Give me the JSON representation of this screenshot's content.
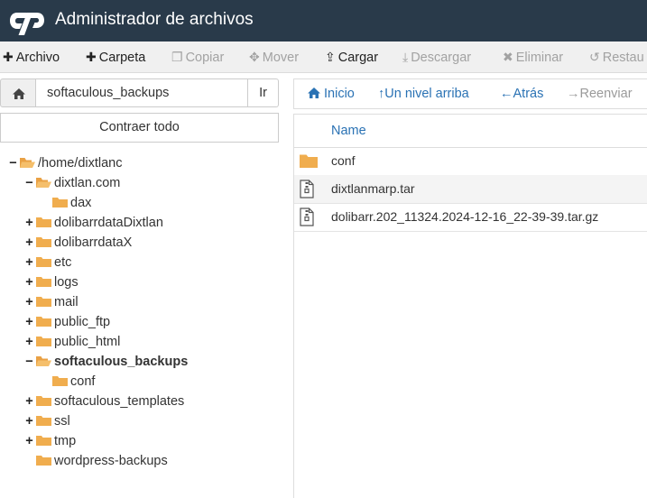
{
  "app": {
    "title": "Administrador de archivos"
  },
  "toolbar": {
    "items": [
      {
        "label": "Archivo",
        "icon": "plus-icon",
        "enabled": true
      },
      {
        "label": "Carpeta",
        "icon": "plus-icon",
        "enabled": true
      },
      {
        "label": "Copiar",
        "icon": "copy-icon",
        "enabled": false
      },
      {
        "label": "Mover",
        "icon": "move-icon",
        "enabled": false
      },
      {
        "label": "Cargar",
        "icon": "upload-icon",
        "enabled": true
      },
      {
        "label": "Descargar",
        "icon": "download-icon",
        "enabled": false
      },
      {
        "label": "Eliminar",
        "icon": "close-icon",
        "enabled": false
      },
      {
        "label": "Restau",
        "icon": "undo-icon",
        "enabled": false
      }
    ]
  },
  "path": {
    "value": "softaculous_backups",
    "go_label": "Ir"
  },
  "tree": {
    "collapse_label": "Contraer todo",
    "items": [
      {
        "label": "/home/dixtlanc",
        "toggle": "−",
        "open": true,
        "bold": false
      },
      {
        "label": "dixtlan.com",
        "toggle": "−",
        "open": true,
        "bold": false
      },
      {
        "label": "dax",
        "toggle": "",
        "open": false,
        "bold": false
      },
      {
        "label": "dolibarrdataDixtlan",
        "toggle": "+",
        "open": false,
        "bold": false
      },
      {
        "label": "dolibarrdataX",
        "toggle": "+",
        "open": false,
        "bold": false
      },
      {
        "label": "etc",
        "toggle": "+",
        "open": false,
        "bold": false
      },
      {
        "label": "logs",
        "toggle": "+",
        "open": false,
        "bold": false
      },
      {
        "label": "mail",
        "toggle": "+",
        "open": false,
        "bold": false
      },
      {
        "label": "public_ftp",
        "toggle": "+",
        "open": false,
        "bold": false
      },
      {
        "label": "public_html",
        "toggle": "+",
        "open": false,
        "bold": false
      },
      {
        "label": "softaculous_backups",
        "toggle": "−",
        "open": true,
        "bold": true
      },
      {
        "label": "conf",
        "toggle": "",
        "open": false,
        "bold": false
      },
      {
        "label": "softaculous_templates",
        "toggle": "+",
        "open": false,
        "bold": false
      },
      {
        "label": "ssl",
        "toggle": "+",
        "open": false,
        "bold": false
      },
      {
        "label": "tmp",
        "toggle": "+",
        "open": false,
        "bold": false
      },
      {
        "label": "wordpress-backups",
        "toggle": "",
        "open": false,
        "bold": false
      }
    ]
  },
  "nav": {
    "items": [
      {
        "label": "Inicio",
        "icon": "home-icon",
        "enabled": true
      },
      {
        "label": "Un nivel arriba",
        "icon": "level-up-icon",
        "enabled": true
      },
      {
        "label": "Atrás",
        "icon": "arrow-left-icon",
        "enabled": true
      },
      {
        "label": "Reenviar",
        "icon": "arrow-right-icon",
        "enabled": false
      }
    ]
  },
  "files": {
    "column_name": "Name",
    "rows": [
      {
        "name": "conf",
        "type": "folder"
      },
      {
        "name": "dixtlanmarp.tar",
        "type": "archive"
      },
      {
        "name": "dolibarr.202_11324.2024-12-16_22-39-39.tar.gz",
        "type": "archive"
      }
    ]
  },
  "colors": {
    "header_bg": "#293a4a",
    "folder": "#f0ad4e",
    "link": "#2a72b4",
    "disabled": "#a2a2a2"
  }
}
